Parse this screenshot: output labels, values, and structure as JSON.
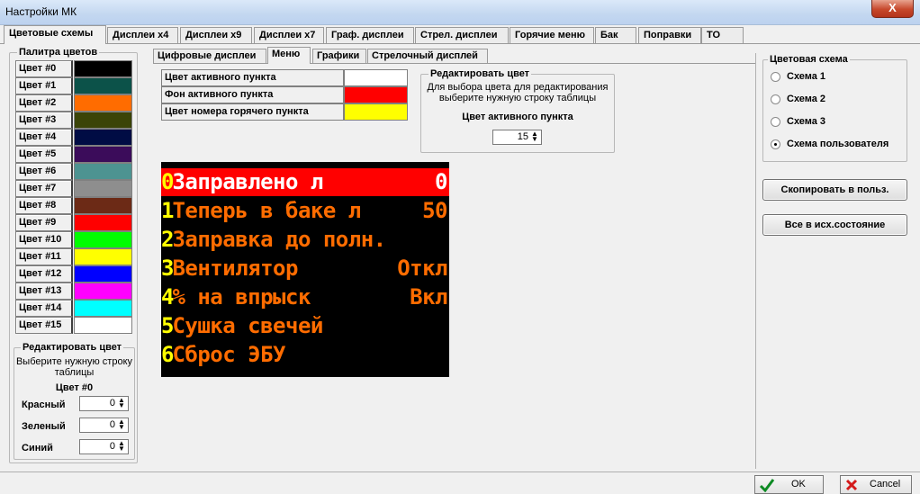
{
  "window": {
    "title": "Настройки МК",
    "close_label": "X"
  },
  "main_tabs": [
    {
      "label": "Цветовые схемы",
      "active": true
    },
    {
      "label": "Дисплеи x4"
    },
    {
      "label": "Дисплеи x9"
    },
    {
      "label": "Дисплеи x7"
    },
    {
      "label": "Граф. дисплеи"
    },
    {
      "label": "Стрел. дисплеи"
    },
    {
      "label": "Горячие меню"
    },
    {
      "label": "Бак"
    },
    {
      "label": "Поправки"
    },
    {
      "label": "ТО"
    }
  ],
  "palette": {
    "title": "Палитра цветов",
    "colors": [
      {
        "label": "Цвет #0",
        "color": "#000000"
      },
      {
        "label": "Цвет #1",
        "color": "#0c5249"
      },
      {
        "label": "Цвет #2",
        "color": "#ff6c00"
      },
      {
        "label": "Цвет #3",
        "color": "#3b4407"
      },
      {
        "label": "Цвет #4",
        "color": "#000c44"
      },
      {
        "label": "Цвет #5",
        "color": "#3b0c5a"
      },
      {
        "label": "Цвет #6",
        "color": "#4d9391"
      },
      {
        "label": "Цвет #7",
        "color": "#8e8e8e"
      },
      {
        "label": "Цвет #8",
        "color": "#6c2a16"
      },
      {
        "label": "Цвет #9",
        "color": "#ff0000"
      },
      {
        "label": "Цвет #10",
        "color": "#00ff00"
      },
      {
        "label": "Цвет #11",
        "color": "#ffff00"
      },
      {
        "label": "Цвет #12",
        "color": "#0000ff"
      },
      {
        "label": "Цвет #13",
        "color": "#ff00ff"
      },
      {
        "label": "Цвет #14",
        "color": "#00ffff"
      },
      {
        "label": "Цвет #15",
        "color": "#ffffff"
      }
    ],
    "edit": {
      "title": "Редактировать цвет",
      "hint": "Выберите нужную строку таблицы",
      "selected": "Цвет #0",
      "fields": [
        {
          "label": "Красный",
          "value": "0"
        },
        {
          "label": "Зеленый",
          "value": "0"
        },
        {
          "label": "Синий",
          "value": "0"
        }
      ]
    }
  },
  "sub_tabs": [
    {
      "label": "Цифровые дисплеи"
    },
    {
      "label": "Меню",
      "active": true
    },
    {
      "label": "Графики"
    },
    {
      "label": "Стрелочный дисплей"
    }
  ],
  "menu_colors": {
    "rows": [
      {
        "label": "Цвет активного пункта",
        "color": "#ffffff"
      },
      {
        "label": "Фон активного пункта",
        "color": "#ff0000"
      },
      {
        "label": "Цвет номера горячего пункта",
        "color": "#ffff00"
      }
    ],
    "edit": {
      "title": "Редактировать цвет",
      "hint": "Для выбора цвета для редактирования выберите нужную строку таблицы",
      "selected": "Цвет активного пункта",
      "value": "15"
    }
  },
  "menu_preview": {
    "lines": [
      {
        "num": "0",
        "text": "Заправлено л",
        "value": "0",
        "active": true
      },
      {
        "num": "1",
        "text": "Теперь в баке л",
        "value": "50"
      },
      {
        "num": "2",
        "text": "Заправка до полн.",
        "value": ""
      },
      {
        "num": "3",
        "text": "Вентилятор",
        "value": "Откл"
      },
      {
        "num": "4",
        "text": "% на впрыск",
        "value": "Вкл"
      },
      {
        "num": "5",
        "text": "Сушка свечей",
        "value": ""
      },
      {
        "num": "6",
        "text": "Сброс ЭБУ",
        "value": ""
      }
    ]
  },
  "scheme": {
    "title": "Цветовая схема",
    "options": [
      {
        "label": "Схема 1",
        "selected": false
      },
      {
        "label": "Схема 2",
        "selected": false
      },
      {
        "label": "Схема 3",
        "selected": false
      },
      {
        "label": "Схема пользователя",
        "selected": true
      }
    ],
    "copy_label": "Скопировать в польз.",
    "reset_label": "Все в исх.состояние"
  },
  "footer": {
    "ok_label": "OK",
    "cancel_label": "Cancel",
    "ok_icon": "checkmark-icon",
    "cancel_icon": "cross-icon"
  }
}
